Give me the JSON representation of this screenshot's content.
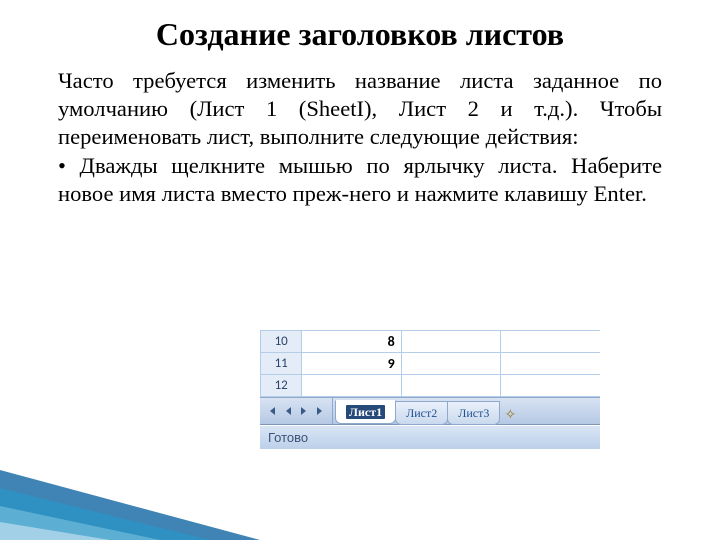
{
  "title": "Создание заголовков листов",
  "paragraph1": "Часто требуется изменить название листа заданное по умолчанию (Лист 1 (SheetI), Лист 2 и т.д.). Чтобы переименовать лист, выполните следующие действия:",
  "bullet1": "• Дважды щелкните мышью по ярлычку листа. Наберите новое имя листа вместо преж-него и нажмите клавишу Enter.",
  "sheet": {
    "rows": [
      {
        "num": "10",
        "a": "8"
      },
      {
        "num": "11",
        "a": "9"
      },
      {
        "num": "12",
        "a": ""
      }
    ],
    "tabs": [
      {
        "label": "Лист1",
        "active": true
      },
      {
        "label": "Лист2",
        "active": false
      },
      {
        "label": "Лист3",
        "active": false
      }
    ],
    "status": "Готово"
  }
}
